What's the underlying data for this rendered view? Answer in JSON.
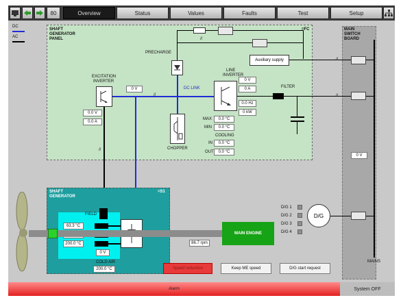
{
  "toolbar": {
    "counter": "80",
    "tabs": [
      "Overview",
      "Status",
      "Values",
      "Faults",
      "Test",
      "Setup"
    ]
  },
  "legend": {
    "dc": "DC",
    "ac": "AC"
  },
  "sg_panel": {
    "title_line1": "SHAFT",
    "title_line2": "GENERATOR",
    "title_line3": "PANEL",
    "id": "=FC",
    "precharge": "PRECHARGE",
    "excitation_line1": "EXCITATION",
    "excitation_line2": "INVERTER",
    "dc_link": "DC LINK",
    "dc_link_voltage": "0 V",
    "excitation_voltage": "0.0 V",
    "excitation_current": "0.0 A",
    "line_inverter_line1": "LINE",
    "line_inverter_line2": "INVERTER",
    "line_voltage": "0 V",
    "line_current": "0 A",
    "line_freq": "0.0 Hz",
    "line_power": "0 kW",
    "chopper": "CHOPPER",
    "filter": "FILTER",
    "aux_supply": "Auxiliary supply",
    "max_label": "MAX",
    "max_value": "0.0 °C",
    "min_label": "MIN",
    "min_value": "0.0 °C",
    "cooling": "COOLING",
    "in_label": "IN",
    "in_value": "0.0 °C",
    "out_label": "OUT",
    "out_value": "0.0 °C"
  },
  "msb": {
    "title_line1": "MAIN",
    "title_line2": "SWITCH",
    "title_line3": "BOARD",
    "voltage": "0 V",
    "mains": "MAINS"
  },
  "shaft_gen": {
    "title_line1": "SHAFT",
    "title_line2": "GENERATOR",
    "id": "=S1",
    "field": "FIELD",
    "temps": [
      "63.3 °C",
      "200.0 °C",
      "200.0 °C"
    ],
    "voltage": "0 V",
    "cold_air": "COLD AIR",
    "cold_air_value": "200.0 °C"
  },
  "rpm": "86.7 rpm",
  "main_engine": "MAIN ENGINE",
  "dg": {
    "labels": [
      "D/G 1",
      "D/G 2",
      "D/G 3",
      "D/G 4"
    ],
    "symbol": "D/G"
  },
  "buttons": {
    "speed_reduction": "Speed reduction",
    "keep_me_speed": "Keep ME speed",
    "dg_start": "D/G start request"
  },
  "status": {
    "alarm": "Alarm",
    "system": "System OFF"
  },
  "colors": {
    "panel_green": "#c5e3c5",
    "shaft_teal": "#1e9e9e",
    "main_engine_green": "#16a316",
    "alarm_red": "#e42020",
    "dc_blue": "#1f2bd6"
  }
}
